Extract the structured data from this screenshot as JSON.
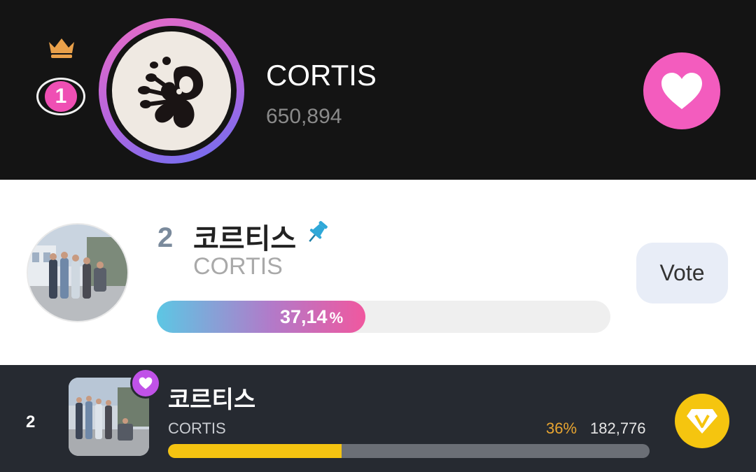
{
  "top_entry": {
    "rank": "1",
    "name": "CORTIS",
    "votes": "650,894",
    "colors": {
      "rank_badge": "#ef4fb4",
      "heart_button": "#f35cbe",
      "crown": "#e9a04a"
    },
    "icons": {
      "crown": "crown-icon",
      "heart": "heart-icon",
      "avatar": "artist-logo"
    }
  },
  "second_entry": {
    "rank": "2",
    "name": "코르티스",
    "subtitle": "CORTIS",
    "percent_label": "37,14",
    "percent_sign": "%",
    "percent_value": 0.3714,
    "vote_label": "Vote",
    "icons": {
      "pin": "pin-icon"
    },
    "colors": {
      "bar_start": "#5cc7e4",
      "bar_end": "#f0589f",
      "vote_button": "#e8edf7"
    }
  },
  "third_entry": {
    "rank": "2",
    "name": "코르티스",
    "subtitle": "CORTIS",
    "percent_label": "36%",
    "percent_value": 0.36,
    "votes": "182,776",
    "icons": {
      "heart_badge": "heart-icon",
      "gem": "gem-icon"
    },
    "colors": {
      "bar_fill": "#f5c411",
      "percent_text": "#e8a531",
      "gem_button": "#f5c50f"
    }
  }
}
